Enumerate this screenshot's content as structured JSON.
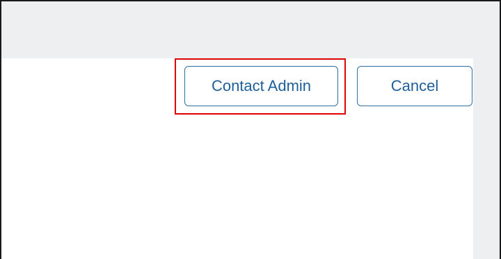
{
  "dialog": {
    "buttons": {
      "contact_admin_label": "Contact Admin",
      "cancel_label": "Cancel"
    }
  },
  "colors": {
    "background_gray": "#edeff1",
    "panel_white": "#ffffff",
    "button_border": "#2f6ea3",
    "button_text": "#1f5f99",
    "highlight_red": "#e00000"
  }
}
